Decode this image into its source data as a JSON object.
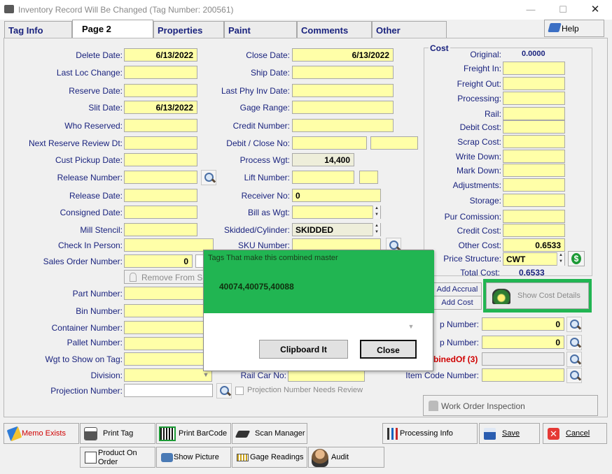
{
  "window": {
    "title": "Inventory Record Will Be Changed  (Tag Number: 200561)"
  },
  "tabs": [
    "Tag Info",
    "Page 2",
    "Properties",
    "Paint",
    "Comments",
    "Other"
  ],
  "help_label": "Help",
  "left": {
    "delete_date": {
      "label": "Delete Date:",
      "value": "6/13/2022"
    },
    "last_loc_change": {
      "label": "Last Loc Change:",
      "value": ""
    },
    "reserve_date": {
      "label": "Reserve Date:",
      "value": ""
    },
    "slit_date": {
      "label": "Slit Date:",
      "value": "6/13/2022"
    },
    "who_reserved": {
      "label": "Who Reserved:",
      "value": ""
    },
    "next_reserve_review": {
      "label": "Next Reserve Review Dt:",
      "value": ""
    },
    "cust_pickup_date": {
      "label": "Cust Pickup Date:",
      "value": ""
    },
    "release_number": {
      "label": "Release Number:",
      "value": ""
    },
    "release_date": {
      "label": "Release Date:",
      "value": ""
    },
    "consigned_date": {
      "label": "Consigned Date:",
      "value": ""
    },
    "mill_stencil": {
      "label": "Mill Stencil:",
      "value": ""
    },
    "check_in_person": {
      "label": "Check In Person:",
      "value": ""
    },
    "sales_order_number": {
      "label": "Sales Order Number:",
      "value": "0"
    },
    "remove_from": "Remove From S",
    "part_number": {
      "label": "Part Number:",
      "value": ""
    },
    "bin_number": {
      "label": "Bin Number:",
      "value": ""
    },
    "container_number": {
      "label": "Container Number:",
      "value": ""
    },
    "pallet_number": {
      "label": "Pallet Number:",
      "value": ""
    },
    "wgt_to_show": {
      "label": "Wgt to Show on Tag:",
      "value": ""
    },
    "division": {
      "label": "Division:",
      "value": ""
    },
    "projection_number": {
      "label": "Projection Number:",
      "value": ""
    },
    "projection_review": "Projection Number Needs Review"
  },
  "middle": {
    "close_date": {
      "label": "Close Date:",
      "value": "6/13/2022"
    },
    "ship_date": {
      "label": "Ship Date:",
      "value": ""
    },
    "last_phy_inv_date": {
      "label": "Last Phy Inv Date:",
      "value": ""
    },
    "gage_range": {
      "label": "Gage Range:",
      "value": ""
    },
    "credit_number": {
      "label": "Credit Number:",
      "value": ""
    },
    "debit_close_no": {
      "label": "Debit / Close No:",
      "value": ""
    },
    "process_wgt": {
      "label": "Process Wgt:",
      "value": "14,400"
    },
    "lift_number": {
      "label": "Lift Number:",
      "value": ""
    },
    "receiver_no": {
      "label": "Receiver No:",
      "value": "0"
    },
    "bill_as_wgt": {
      "label": "Bill as Wgt:",
      "value": ""
    },
    "skidded_cylinder": {
      "label": "Skidded/Cylinder:",
      "value": "SKIDDED"
    },
    "sku_number": {
      "label": "SKU Number:",
      "value": ""
    },
    "rail_car_no": {
      "label": "Rail Car No:",
      "value": ""
    }
  },
  "cost": {
    "title": "Cost",
    "original": {
      "label": "Original:",
      "value": "0.0000"
    },
    "freight_in": {
      "label": "Freight In:",
      "value": ""
    },
    "freight_out": {
      "label": "Freight Out:",
      "value": ""
    },
    "processing": {
      "label": "Processing:",
      "value": ""
    },
    "rail": {
      "label": "Rail:",
      "value": ""
    },
    "debit_cost": {
      "label": "Debit Cost:",
      "value": ""
    },
    "scrap_cost": {
      "label": "Scrap Cost:",
      "value": ""
    },
    "write_down": {
      "label": "Write Down:",
      "value": ""
    },
    "mark_down": {
      "label": "Mark Down:",
      "value": ""
    },
    "adjustments": {
      "label": "Adjustments:",
      "value": ""
    },
    "storage": {
      "label": "Storage:",
      "value": ""
    },
    "pur_comission": {
      "label": "Pur Comission:",
      "value": ""
    },
    "credit_cost": {
      "label": "Credit Cost:",
      "value": ""
    },
    "other_cost": {
      "label": "Other Cost:",
      "value": "0.6533"
    },
    "price_structure": {
      "label": "Price Structure:",
      "value": "CWT"
    },
    "total_cost": {
      "label": "Total Cost:",
      "value": "0.6533"
    },
    "add_accrual": "Add Accrual",
    "add_cost": "Add Cost",
    "show_cost_details": "Show Cost Details"
  },
  "right_lower": {
    "p_number_1": {
      "label": "p Number:",
      "value": "0"
    },
    "p_number_2": {
      "label": "p Number:",
      "value": "0"
    },
    "combined_of": "binedOf (3)",
    "item_code_number": {
      "label": "Item Code Number:",
      "value": ""
    },
    "work_order_inspection": "Work Order Inspection"
  },
  "popup": {
    "header": "Tags That make this combined master",
    "tags": "40074,40075,40088",
    "clipboard_button": "Clipboard It",
    "close_button": "Close"
  },
  "buttons": {
    "memo_exists": "Memo Exists",
    "print_tag": "Print Tag",
    "print_barcode": "Print BarCode",
    "scan_manager": "Scan Manager",
    "processing_info": "Processing Info",
    "save": "Save",
    "cancel": "Cancel",
    "product_on_order": "Product On Order",
    "show_picture": "Show Picture",
    "gage_readings": "Gage Readings",
    "audit": "Audit"
  },
  "colors": {
    "field": "#ffffa8",
    "label": "#1a237e",
    "popup_header": "#21b552",
    "memo": "#d00000"
  }
}
